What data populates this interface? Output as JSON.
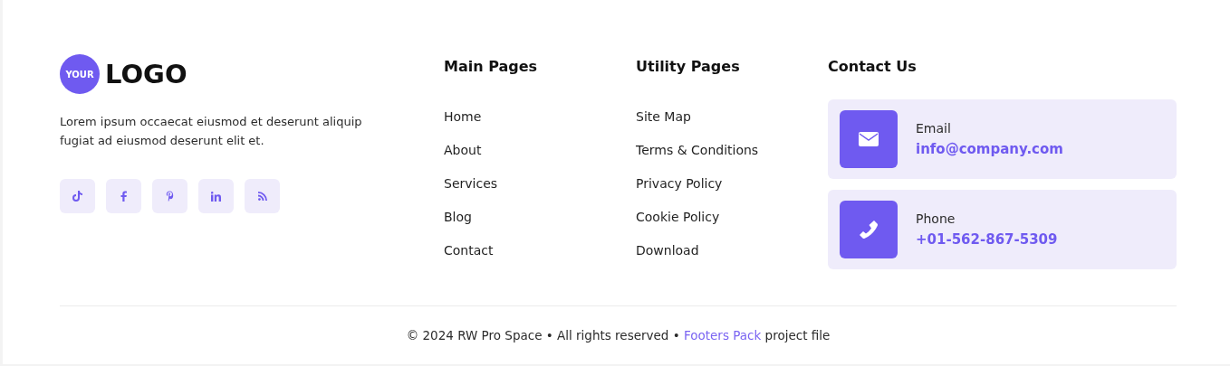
{
  "brand": {
    "badge": "YOUR",
    "name": "LOGO"
  },
  "description": "Lorem ipsum occaecat eiusmod et deserunt aliquip fugiat ad eiusmod deserunt elit et.",
  "social": [
    {
      "kind": "tiktok"
    },
    {
      "kind": "facebook"
    },
    {
      "kind": "pinterest"
    },
    {
      "kind": "linkedin"
    },
    {
      "kind": "rss"
    }
  ],
  "columns": [
    {
      "title": "Main Pages",
      "links": [
        "Home",
        "About",
        "Services",
        "Blog",
        "Contact"
      ]
    },
    {
      "title": "Utility Pages",
      "links": [
        "Site Map",
        "Terms & Conditions",
        "Privacy Policy",
        "Cookie Policy",
        "Download"
      ]
    }
  ],
  "contact": {
    "title": "Contact Us",
    "items": [
      {
        "kind": "email",
        "label": "Email",
        "value": "info@company.com"
      },
      {
        "kind": "phone",
        "label": "Phone",
        "value": "+01-562-867-5309"
      }
    ]
  },
  "footer": {
    "prefix": "© 2024 RW Pro Space • All rights reserved • ",
    "link": "Footers Pack",
    "suffix": " project file"
  }
}
